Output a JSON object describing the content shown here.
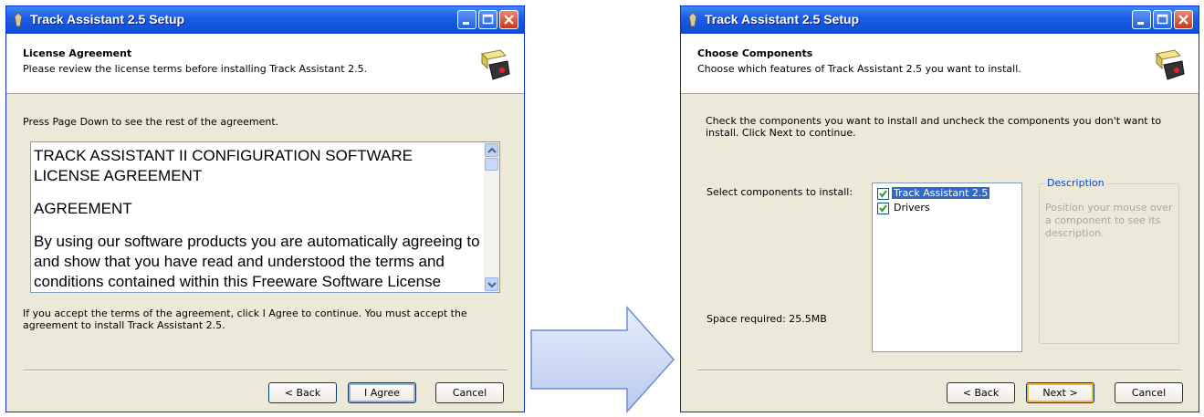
{
  "window1": {
    "title": "Track Assistant 2.5 Setup",
    "header_title": "License Agreement",
    "header_subtitle": "Please review the license terms before installing Track Assistant 2.5.",
    "instruction": "Press Page Down to see the rest of the agreement.",
    "eula": {
      "heading": "TRACK ASSISTANT II CONFIGURATION SOFTWARE LICENSE AGREEMENT",
      "section": "AGREEMENT",
      "body": "By using our software products you are automatically agreeing to and show that you have read and understood the terms and conditions contained within this Freeware Software License"
    },
    "accept_note": "If you accept the terms of the agreement, click I Agree to continue. You must accept the agreement to install Track Assistant 2.5.",
    "buttons": {
      "back": "< Back",
      "agree": "I Agree",
      "cancel": "Cancel"
    }
  },
  "window2": {
    "title": "Track Assistant 2.5 Setup",
    "header_title": "Choose Components",
    "header_subtitle": "Choose which features of Track Assistant 2.5 you want to install.",
    "instruction": "Check the components you want to install and uncheck the components you don't want to install. Click Next to continue.",
    "select_label": "Select components to install:",
    "components": [
      {
        "label": "Track Assistant 2.5",
        "checked": true,
        "selected": true
      },
      {
        "label": "Drivers",
        "checked": true,
        "selected": false
      }
    ],
    "description": {
      "legend": "Description",
      "text": "Position your mouse over a component to see its description."
    },
    "space_required": "Space required: 25.5MB",
    "buttons": {
      "back": "< Back",
      "next": "Next >",
      "cancel": "Cancel"
    }
  },
  "icons": {
    "title_icon": "setup-icon",
    "header_icon": "installer-box-icon",
    "arrow": "right-arrow-icon"
  },
  "colors": {
    "titlebar": "#0d4ad5",
    "dialog_bg": "#ece9d8",
    "selection": "#316ac5",
    "description_legend": "#0046d5",
    "arrow_fill": "#c8d6f2"
  }
}
